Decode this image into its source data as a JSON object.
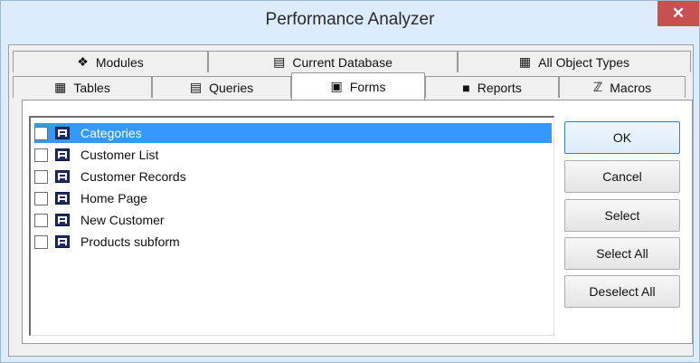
{
  "window": {
    "title": "Performance Analyzer",
    "close_label": "✕"
  },
  "tabs": {
    "back_row": [
      {
        "label": "Modules",
        "icon": "modules-icon"
      },
      {
        "label": "Current Database",
        "icon": "database-icon"
      },
      {
        "label": "All Object Types",
        "icon": "object-types-icon"
      }
    ],
    "front_row": [
      {
        "label": "Tables",
        "icon": "table-icon"
      },
      {
        "label": "Queries",
        "icon": "query-icon"
      },
      {
        "label": "Forms",
        "icon": "form-icon",
        "selected": true
      },
      {
        "label": "Reports",
        "icon": "report-icon"
      },
      {
        "label": "Macros",
        "icon": "macro-icon"
      }
    ]
  },
  "list": {
    "items": [
      {
        "label": "Categories",
        "checked": false,
        "selected": true
      },
      {
        "label": "Customer List",
        "checked": false
      },
      {
        "label": "Customer Records",
        "checked": false
      },
      {
        "label": "Home Page",
        "checked": false
      },
      {
        "label": "New Customer",
        "checked": false
      },
      {
        "label": "Products subform",
        "checked": false
      }
    ]
  },
  "buttons": {
    "ok": "OK",
    "cancel": "Cancel",
    "select": "Select",
    "select_all": "Select All",
    "deselect_all": "Deselect All"
  },
  "colors": {
    "selection": "#3399ff",
    "close_button": "#c75050",
    "titlebar": "#dcecfc"
  }
}
